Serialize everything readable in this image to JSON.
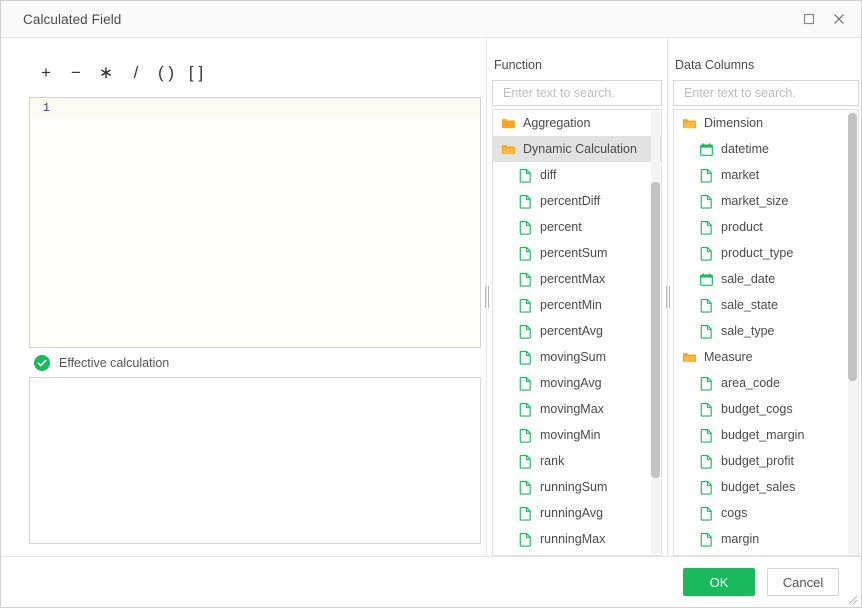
{
  "window": {
    "title": "Calculated Field",
    "maximize_icon": "maximize-icon",
    "close_icon": "close-icon"
  },
  "toolbar": {
    "operators": [
      {
        "label": "+",
        "name": "operator-plus"
      },
      {
        "label": "−",
        "name": "operator-minus"
      },
      {
        "label": "∗",
        "name": "operator-multiply"
      },
      {
        "label": "/",
        "name": "operator-divide"
      },
      {
        "label": "( )",
        "name": "operator-parentheses"
      },
      {
        "label": "[ ]",
        "name": "operator-brackets"
      }
    ]
  },
  "editor": {
    "line_number": "1",
    "content": ""
  },
  "status": {
    "icon": "check-circle-icon",
    "text": "Effective calculation",
    "color": "#18ba5b"
  },
  "preview": {
    "content": ""
  },
  "function_panel": {
    "title": "Function",
    "search_placeholder": "Enter text to search.",
    "search_value": "",
    "items": [
      {
        "label": "Aggregation",
        "icon": "folder-icon",
        "type": "folder",
        "selected": false
      },
      {
        "label": "Dynamic Calculation",
        "icon": "folder-open-icon",
        "type": "folder",
        "selected": true
      },
      {
        "label": "diff",
        "icon": "file-icon",
        "type": "function",
        "selected": false
      },
      {
        "label": "percentDiff",
        "icon": "file-icon",
        "type": "function",
        "selected": false
      },
      {
        "label": "percent",
        "icon": "file-icon",
        "type": "function",
        "selected": false
      },
      {
        "label": "percentSum",
        "icon": "file-icon",
        "type": "function",
        "selected": false
      },
      {
        "label": "percentMax",
        "icon": "file-icon",
        "type": "function",
        "selected": false
      },
      {
        "label": "percentMin",
        "icon": "file-icon",
        "type": "function",
        "selected": false
      },
      {
        "label": "percentAvg",
        "icon": "file-icon",
        "type": "function",
        "selected": false
      },
      {
        "label": "movingSum",
        "icon": "file-icon",
        "type": "function",
        "selected": false
      },
      {
        "label": "movingAvg",
        "icon": "file-icon",
        "type": "function",
        "selected": false
      },
      {
        "label": "movingMax",
        "icon": "file-icon",
        "type": "function",
        "selected": false
      },
      {
        "label": "movingMin",
        "icon": "file-icon",
        "type": "function",
        "selected": false
      },
      {
        "label": "rank",
        "icon": "file-icon",
        "type": "function",
        "selected": false
      },
      {
        "label": "runningSum",
        "icon": "file-icon",
        "type": "function",
        "selected": false
      },
      {
        "label": "runningAvg",
        "icon": "file-icon",
        "type": "function",
        "selected": false
      },
      {
        "label": "runningMax",
        "icon": "file-icon",
        "type": "function",
        "selected": false
      }
    ]
  },
  "columns_panel": {
    "title": "Data Columns",
    "search_placeholder": "Enter text to search.",
    "search_value": "",
    "items": [
      {
        "label": "Dimension",
        "icon": "folder-open-icon",
        "type": "folder"
      },
      {
        "label": "datetime",
        "icon": "calendar-icon",
        "type": "date"
      },
      {
        "label": "market",
        "icon": "file-icon",
        "type": "text"
      },
      {
        "label": "market_size",
        "icon": "file-icon",
        "type": "text"
      },
      {
        "label": "product",
        "icon": "file-icon",
        "type": "text"
      },
      {
        "label": "product_type",
        "icon": "file-icon",
        "type": "text"
      },
      {
        "label": "sale_date",
        "icon": "calendar-icon",
        "type": "date"
      },
      {
        "label": "sale_state",
        "icon": "file-icon",
        "type": "text"
      },
      {
        "label": "sale_type",
        "icon": "file-icon",
        "type": "text"
      },
      {
        "label": "Measure",
        "icon": "folder-open-icon",
        "type": "folder"
      },
      {
        "label": "area_code",
        "icon": "file-icon",
        "type": "number"
      },
      {
        "label": "budget_cogs",
        "icon": "file-icon",
        "type": "number"
      },
      {
        "label": "budget_margin",
        "icon": "file-icon",
        "type": "number"
      },
      {
        "label": "budget_profit",
        "icon": "file-icon",
        "type": "number"
      },
      {
        "label": "budget_sales",
        "icon": "file-icon",
        "type": "number"
      },
      {
        "label": "cogs",
        "icon": "file-icon",
        "type": "number"
      },
      {
        "label": "margin",
        "icon": "file-icon",
        "type": "number"
      }
    ]
  },
  "footer": {
    "ok_label": "OK",
    "cancel_label": "Cancel",
    "ok_color": "#18ba5b"
  }
}
